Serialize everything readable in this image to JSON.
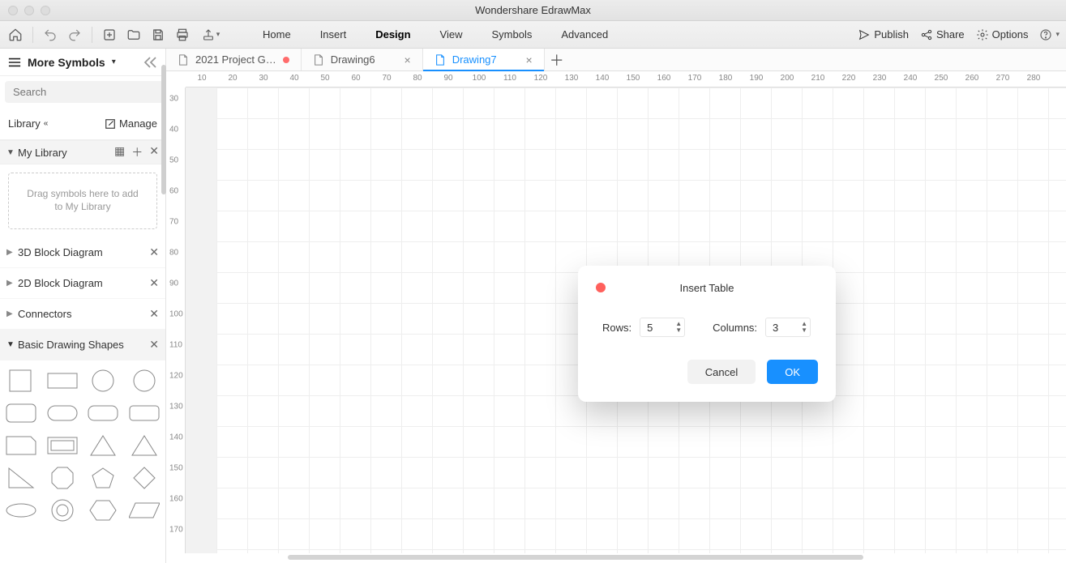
{
  "app": {
    "title": "Wondershare EdrawMax"
  },
  "menu": {
    "items": [
      "Home",
      "Insert",
      "Design",
      "View",
      "Symbols",
      "Advanced"
    ],
    "active": "Design"
  },
  "toolbar_right": {
    "publish": "Publish",
    "share": "Share",
    "options": "Options"
  },
  "sidebar": {
    "title": "More Symbols",
    "search_placeholder": "Search",
    "search_button": "Search",
    "library_label": "Library",
    "manage_label": "Manage",
    "mylib": {
      "title": "My Library",
      "dropzone": "Drag symbols here to add to My Library"
    },
    "categories": [
      {
        "label": "3D Block Diagram",
        "expanded": false
      },
      {
        "label": "2D Block Diagram",
        "expanded": false
      },
      {
        "label": "Connectors",
        "expanded": false
      },
      {
        "label": "Basic Drawing Shapes",
        "expanded": true
      }
    ]
  },
  "tabs": [
    {
      "label": "2021 Project G…",
      "unsaved": true,
      "active": false
    },
    {
      "label": "Drawing6",
      "unsaved": false,
      "active": false
    },
    {
      "label": "Drawing7",
      "unsaved": false,
      "active": true
    }
  ],
  "ruler": {
    "top": [
      "10",
      "20",
      "30",
      "40",
      "50",
      "60",
      "70",
      "80",
      "90",
      "100",
      "110",
      "120",
      "130",
      "140",
      "150",
      "160",
      "170",
      "180",
      "190",
      "200",
      "210",
      "220",
      "230",
      "240",
      "250",
      "260",
      "270",
      "280"
    ],
    "left": [
      "30",
      "40",
      "50",
      "60",
      "70",
      "80",
      "90",
      "100",
      "110",
      "120",
      "130",
      "140",
      "150",
      "160",
      "170"
    ]
  },
  "dialog": {
    "title": "Insert Table",
    "rows_label": "Rows:",
    "rows_value": "5",
    "cols_label": "Columns:",
    "cols_value": "3",
    "cancel": "Cancel",
    "ok": "OK"
  }
}
